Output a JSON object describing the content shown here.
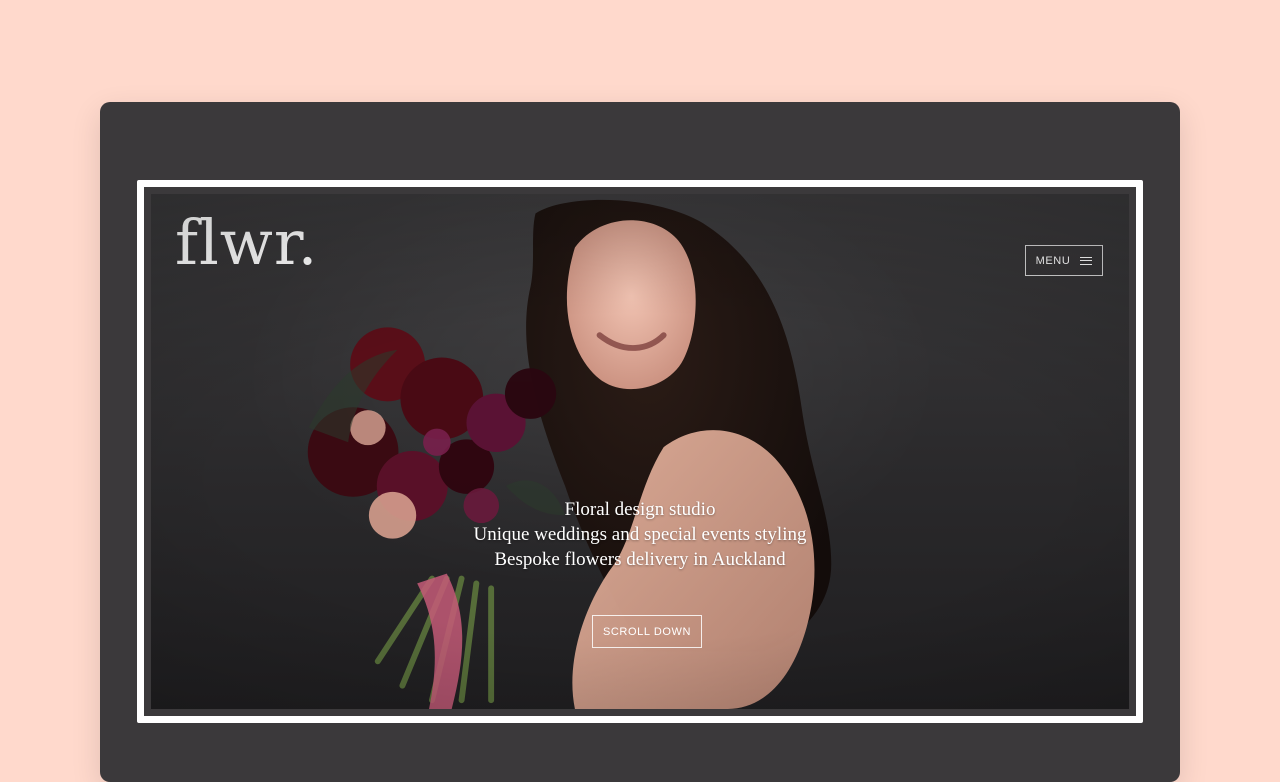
{
  "colors": {
    "page_bg": "#FFD9CC",
    "window_bg": "#3B393B",
    "frame_border": "#FFFFFF",
    "text": "#FFFFFF"
  },
  "site": {
    "logo": "flwr.",
    "menu_label": "MENU",
    "tagline": [
      "Floral design studio",
      "Unique weddings and special events styling",
      "Bespoke flowers delivery in Auckland"
    ],
    "scroll_label": "SCROLL DOWN"
  },
  "icons": {
    "menu": "hamburger-icon"
  }
}
